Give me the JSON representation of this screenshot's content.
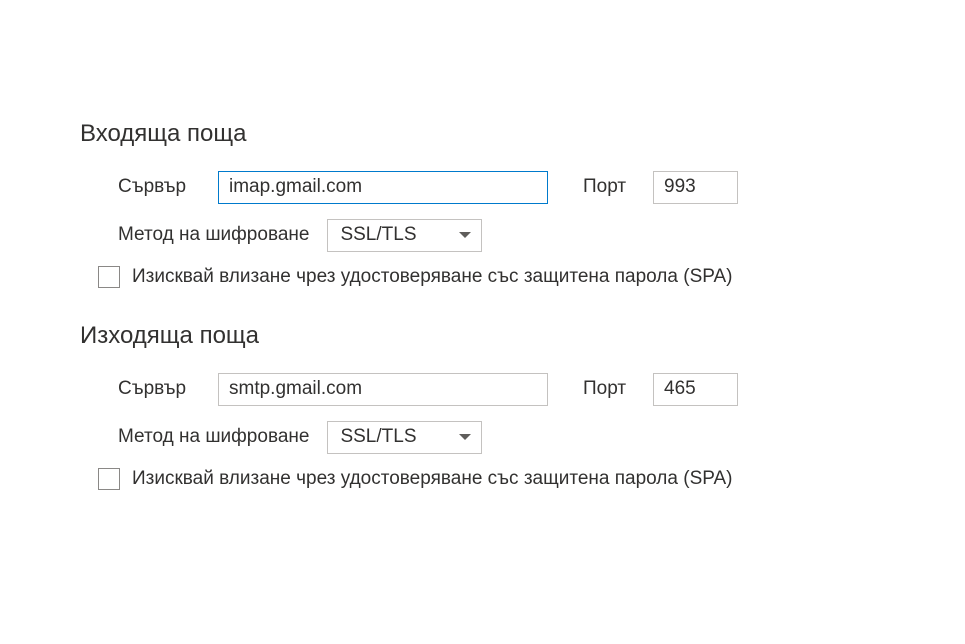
{
  "incoming": {
    "title": "Входяща поща",
    "server_label": "Сървър",
    "server_value": "imap.gmail.com",
    "port_label": "Порт",
    "port_value": "993",
    "encryption_label": "Метод на шифроване",
    "encryption_value": "SSL/TLS",
    "spa_label": "Изисквай влизане чрез удостоверяване със защитена парола (SPA)"
  },
  "outgoing": {
    "title": "Изходяща поща",
    "server_label": "Сървър",
    "server_value": "smtp.gmail.com",
    "port_label": "Порт",
    "port_value": "465",
    "encryption_label": "Метод на шифроване",
    "encryption_value": "SSL/TLS",
    "spa_label": "Изисквай влизане чрез удостоверяване със защитена парола (SPA)"
  }
}
